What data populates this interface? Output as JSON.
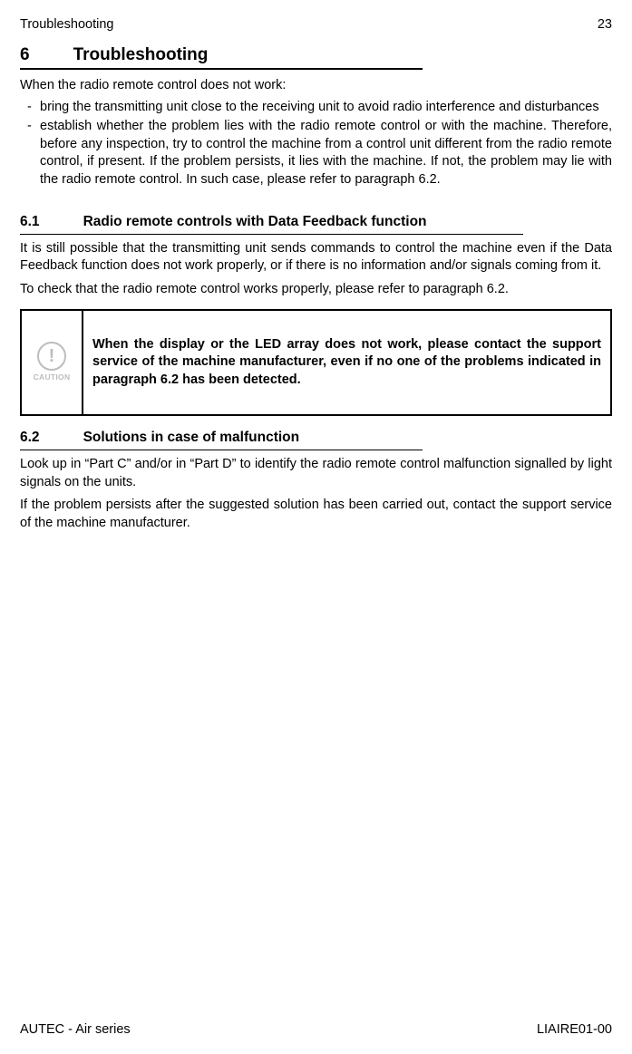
{
  "header": {
    "left": "Troubleshooting",
    "right": "23"
  },
  "chapter": {
    "num": "6",
    "title": "Troubleshooting"
  },
  "intro": "When the radio remote control does not work:",
  "bullets": [
    "bring the transmitting unit close to the receiving unit to avoid radio interference and disturbances",
    "establish whether the problem lies with the radio remote control or with the machine. Therefore, before any inspection, try to control the machine from a control unit different from the radio remote control, if present. If the problem persists, it lies with the machine. If not, the problem may lie with the radio remote control. In such case, please refer to paragraph 6.2."
  ],
  "sec61": {
    "num": "6.1",
    "title": "Radio remote controls with Data Feedback function",
    "p1": "It is still possible that the transmitting unit sends commands to control the machine even if the Data Feedback function does not work properly, or if there is no information and/or signals coming from it.",
    "p2": "To check that the radio remote control works properly, please refer to paragraph 6.2."
  },
  "caution": {
    "icon_label": "CAUTION",
    "glyph": "!",
    "text": "When the display or the LED array does not work, please contact the support service of the machine manufacturer, even if no one of the problems indicated in paragraph 6.2 has been detected."
  },
  "sec62": {
    "num": "6.2",
    "title": "Solutions in case of malfunction",
    "p1": "Look up in “Part C” and/or in “Part D” to identify the radio remote control malfunction signalled by light signals on the units.",
    "p2": "If the problem persists after the suggested solution has been carried out, contact the support service of the machine manufacturer."
  },
  "footer": {
    "left": "AUTEC - Air series",
    "right": "LIAIRE01-00"
  }
}
